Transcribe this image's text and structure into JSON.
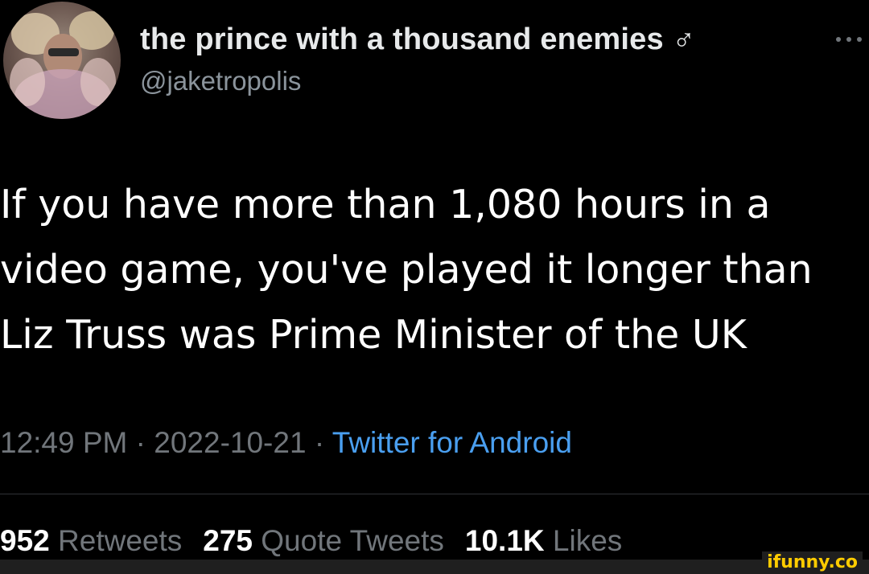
{
  "tweet": {
    "display_name": "the prince with a thousand enemies ♂",
    "handle": "@jaketropolis",
    "text_lines": [
      "If you have more than 1,080 hours in a",
      "video game, you've played it longer than",
      "Liz Truss was Prime Minister of the UK"
    ],
    "time": "12:49 PM",
    "separator": "·",
    "date": "2022-10-21",
    "source": "Twitter for Android"
  },
  "stats": {
    "retweets_count": "952",
    "retweets_label": "Retweets",
    "quotes_count": "275",
    "quotes_label": "Quote Tweets",
    "likes_count": "10.1K",
    "likes_label": "Likes"
  },
  "watermark": "ifunny.co",
  "colors": {
    "background": "#000000",
    "primary_text": "#e7e9ea",
    "secondary_text": "#71767b",
    "source_link": "#4a9ff0",
    "watermark": "#ffcc00"
  },
  "icons": {
    "more": "more-options-icon"
  }
}
